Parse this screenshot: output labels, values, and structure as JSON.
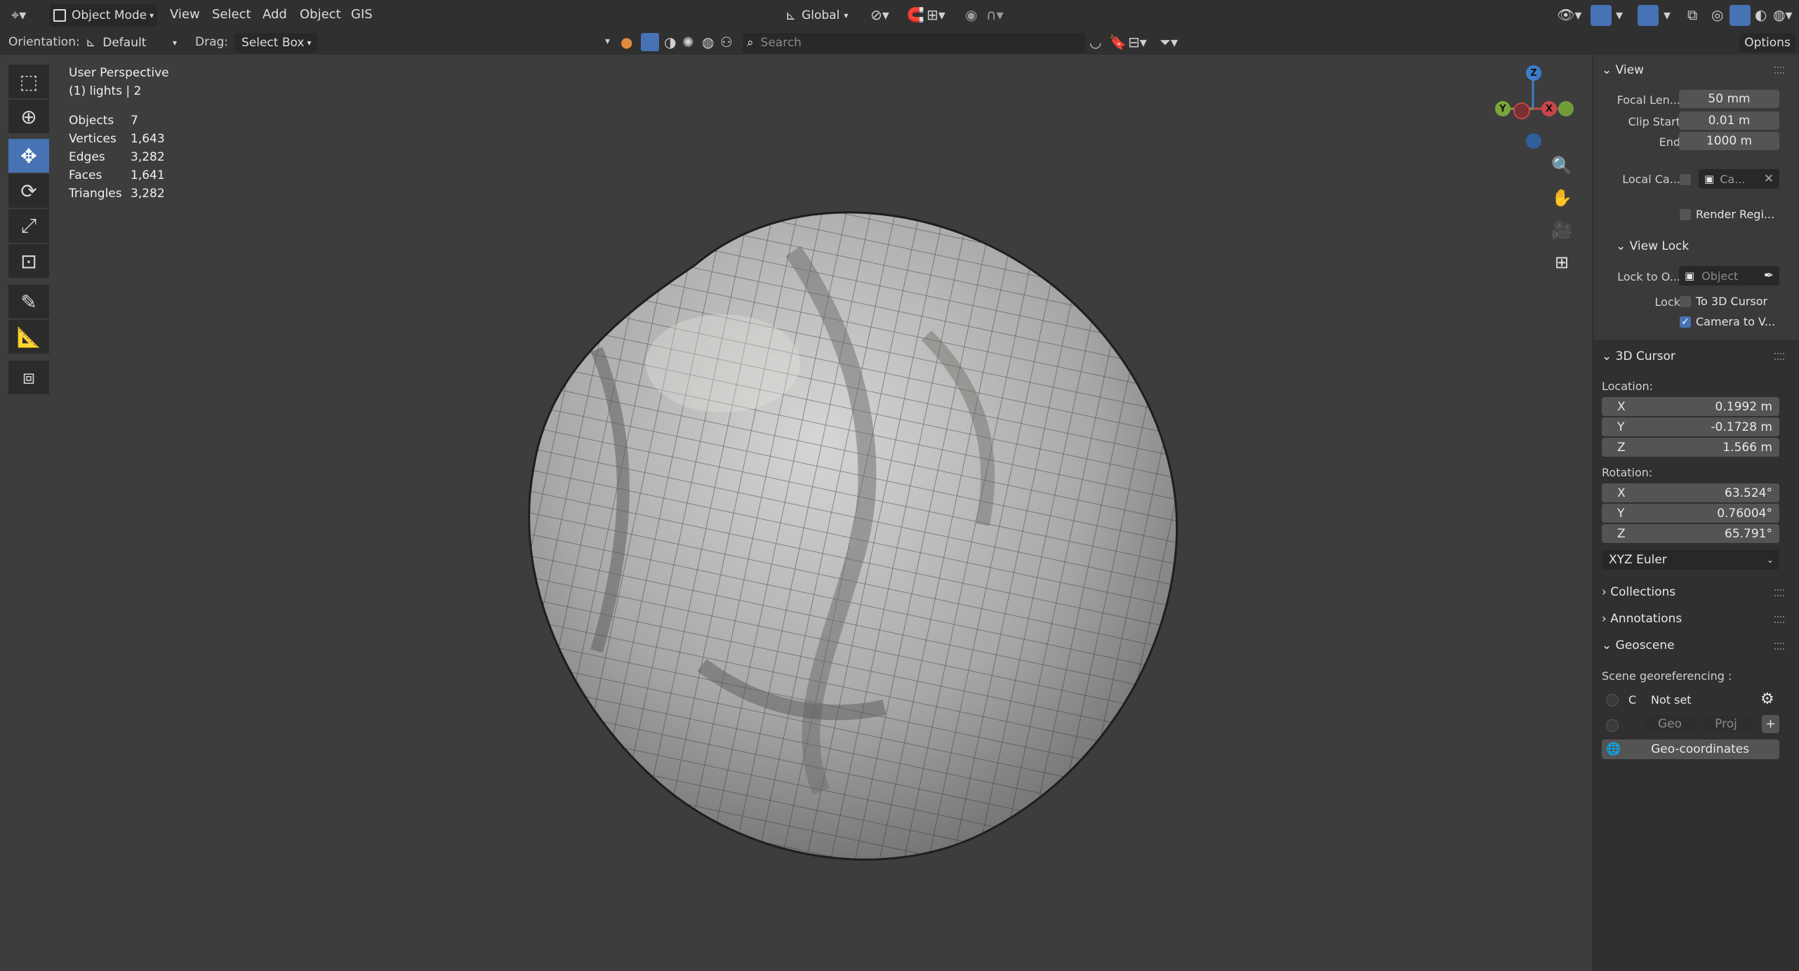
{
  "header": {
    "mode_label": "Object Mode",
    "menus": [
      "View",
      "Select",
      "Add",
      "Object",
      "GIS"
    ],
    "transform_orientation": "Global"
  },
  "tool_settings": {
    "orientation_label": "Orientation:",
    "orientation_value": "Default",
    "drag_label": "Drag:",
    "drag_value": "Select Box",
    "search_placeholder": "Search",
    "options_label": "Options"
  },
  "overlay": {
    "view_name": "User Perspective",
    "collection_info": "(1) lights | 2",
    "stats": [
      {
        "label": "Objects",
        "value": "7"
      },
      {
        "label": "Vertices",
        "value": "1,643"
      },
      {
        "label": "Edges",
        "value": "3,282"
      },
      {
        "label": "Faces",
        "value": "1,641"
      },
      {
        "label": "Triangles",
        "value": "3,282"
      }
    ]
  },
  "gizmo": {
    "z": "Z",
    "y": "Y",
    "x": "X"
  },
  "sidebar": {
    "view": {
      "title": "View",
      "focal_label": "Focal Len...",
      "focal_value": "50 mm",
      "clip_start_label": "Clip Start",
      "clip_start_value": "0.01 m",
      "end_label": "End",
      "end_value": "1000 m",
      "local_camera_label": "Local Ca...",
      "local_camera_value": "Ca...",
      "render_region_label": "Render Regi..."
    },
    "view_lock": {
      "title": "View Lock",
      "lock_to_label": "Lock to O...",
      "lock_to_placeholder": "Object",
      "lock_label": "Lock",
      "to_cursor_label": "To 3D Cursor",
      "camera_to_view_label": "Camera to V..."
    },
    "cursor": {
      "title": "3D Cursor",
      "location_label": "Location:",
      "location": [
        {
          "axis": "X",
          "value": "0.1992 m"
        },
        {
          "axis": "Y",
          "value": "-0.1728 m"
        },
        {
          "axis": "Z",
          "value": "1.566 m"
        }
      ],
      "rotation_label": "Rotation:",
      "rotation": [
        {
          "axis": "X",
          "value": "63.524°"
        },
        {
          "axis": "Y",
          "value": "0.76004°"
        },
        {
          "axis": "Z",
          "value": "65.791°"
        }
      ],
      "rotation_mode": "XYZ Euler"
    },
    "collections_title": "Collections",
    "annotations_title": "Annotations",
    "geoscene": {
      "title": "Geoscene",
      "georef_label": "Scene georeferencing :",
      "crs_letter": "C",
      "crs_value": "Not set",
      "geo_label": "Geo",
      "proj_label": "Proj",
      "geocoords_label": "Geo-coordinates"
    }
  },
  "colors": {
    "accent": "#4772b3",
    "viewport_bg": "#3d3d3d",
    "axis_x": "#c8464a",
    "axis_y": "#7aa53a",
    "axis_z": "#3c7ecb"
  }
}
